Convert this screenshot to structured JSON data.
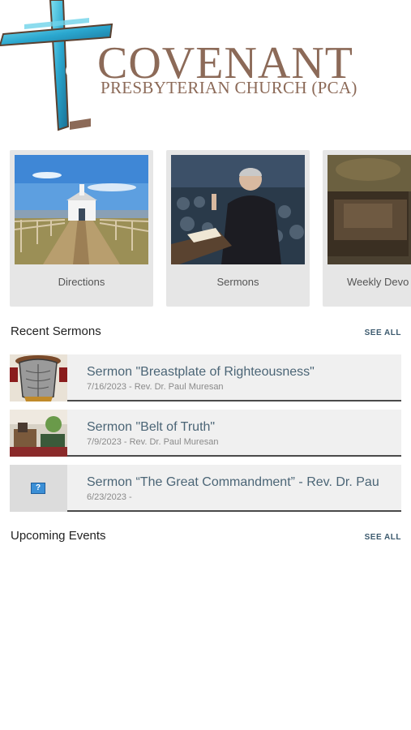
{
  "header": {
    "logo_title": "COVENANT",
    "logo_subtitle": "PRESBYTERIAN CHURCH (PCA)"
  },
  "cards": [
    {
      "label": "Directions",
      "icon": "church-road-photo"
    },
    {
      "label": "Sermons",
      "icon": "preacher-photo"
    },
    {
      "label": "Weekly Devo",
      "icon": "bible-photo"
    }
  ],
  "recent_sermons": {
    "title": "Recent Sermons",
    "see_all": "SEE ALL",
    "items": [
      {
        "title": "Sermon \"Breastplate of Righteousness\"",
        "meta": "7/16/2023 - Rev. Dr. Paul Muresan",
        "icon": "breastplate-thumbnail"
      },
      {
        "title": "Sermon \"Belt of Truth\"",
        "meta": "7/9/2023 - Rev. Dr. Paul Muresan",
        "icon": "sanctuary-thumbnail"
      },
      {
        "title": "Sermon “The Great Commandment” - Rev. Dr. Pau",
        "meta": "6/23/2023 -",
        "icon": "missing-image-icon"
      }
    ]
  },
  "upcoming_events": {
    "title": "Upcoming Events",
    "see_all": "SEE ALL"
  },
  "colors": {
    "logo_brown": "#8c6a58",
    "cross_blue": "#3fb7d6",
    "card_bg": "#e6e6e6",
    "link_blue": "#3c5a6e",
    "sermon_title": "#4b6576"
  }
}
